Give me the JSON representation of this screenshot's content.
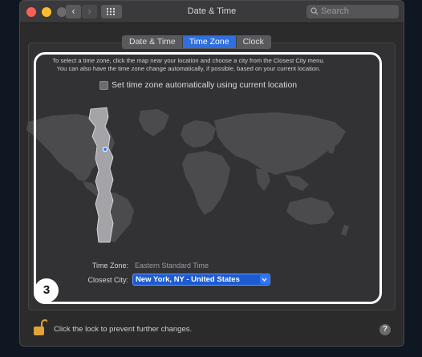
{
  "window": {
    "title": "Date & Time",
    "search_placeholder": "Search",
    "traffic_colors": {
      "close": "#ff5f57",
      "minimize": "#febc2e",
      "zoom": "#6b6b6b"
    },
    "nav_back_glyph": "‹",
    "nav_forward_glyph": "›"
  },
  "tabs": [
    {
      "label": "Date & Time",
      "active": false
    },
    {
      "label": "Time Zone",
      "active": true
    },
    {
      "label": "Clock",
      "active": false
    }
  ],
  "time_zone": {
    "instructions_line1": "To select a time zone, click the map near your location and choose a city from the Closest City menu.",
    "instructions_line2": "You can also have the time zone change automatically, if possible, based on your current location.",
    "auto_checkbox_label": "Set time zone automatically using current location",
    "auto_checked": false,
    "tz_label": "Time Zone:",
    "tz_value": "Eastern Standard Time",
    "city_label": "Closest City:",
    "city_value": "New York, NY - United States"
  },
  "annotation": {
    "step_number": "3"
  },
  "footer": {
    "lock_text": "Click the lock to prevent further changes.",
    "help_glyph": "?"
  },
  "colors": {
    "accent": "#2f6fe0",
    "map_land": "#4b4b4e",
    "selected_zone": "#a4a4a8",
    "lock": "#e2a33a"
  },
  "icons": {
    "lock": "lock-open-icon",
    "search": "search-icon",
    "grid": "grid-icon",
    "location_pin": "location-pin-icon"
  }
}
